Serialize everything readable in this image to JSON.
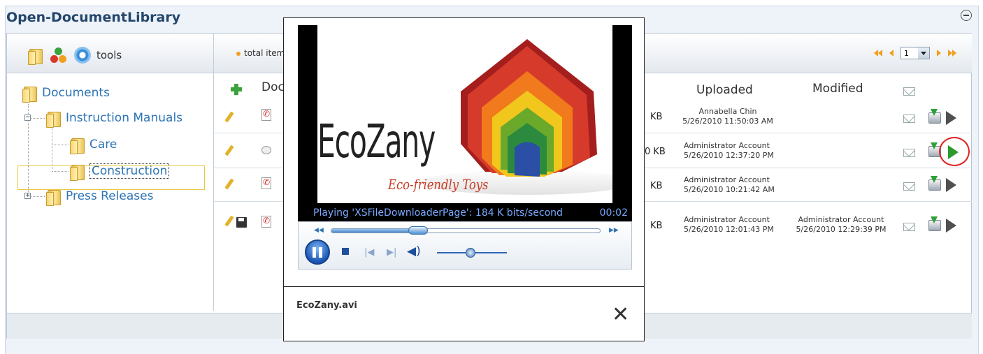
{
  "panel": {
    "title": "Open-DocumentLibrary"
  },
  "left_toolbar": {
    "tools_label": "tools"
  },
  "right_toolbar": {
    "total_items_label": "total item",
    "page_selected": "1"
  },
  "tree": {
    "root": "Documents",
    "children": [
      {
        "label": "Instruction Manuals",
        "expanded": true,
        "children": [
          "Care",
          "Construction"
        ]
      },
      {
        "label": "Press Releases",
        "expanded": false
      }
    ],
    "selected": "Construction"
  },
  "grid": {
    "columns": {
      "document": "Doc",
      "uploaded": "Uploaded",
      "modified": "Modified"
    },
    "rows": [
      {
        "size": "KB",
        "uploaded_by": "Annabella Chin",
        "uploaded_at": "5/26/2010 11:50:03 AM",
        "modified_by": "",
        "modified_at": ""
      },
      {
        "size": "0 KB",
        "uploaded_by": "Administrator Account",
        "uploaded_at": "5/26/2010 12:37:20 PM",
        "modified_by": "",
        "modified_at": ""
      },
      {
        "size": "KB",
        "uploaded_by": "Administrator Account",
        "uploaded_at": "5/26/2010 10:21:42 AM",
        "modified_by": "",
        "modified_at": ""
      },
      {
        "size": "KB",
        "uploaded_by": "Administrator Account",
        "uploaded_at": "5/26/2010 12:01:43 PM",
        "modified_by": "Administrator Account",
        "modified_at": "5/26/2010 12:29:39 PM"
      }
    ]
  },
  "player": {
    "logo_title": "EcoZany",
    "logo_subtitle": "Eco-friendly Toys",
    "status": "Playing 'XSFileDownloaderPage': 184 K bits/second",
    "time": "00:02",
    "progress": 0.32,
    "volume": 0.48,
    "file_name": "EcoZany.avi"
  },
  "colors": {
    "title": "#24466b",
    "link": "#2e74b5",
    "accent_orange": "#f0a020",
    "play_green": "#2e9a2e",
    "highlight_red": "#e02020"
  }
}
